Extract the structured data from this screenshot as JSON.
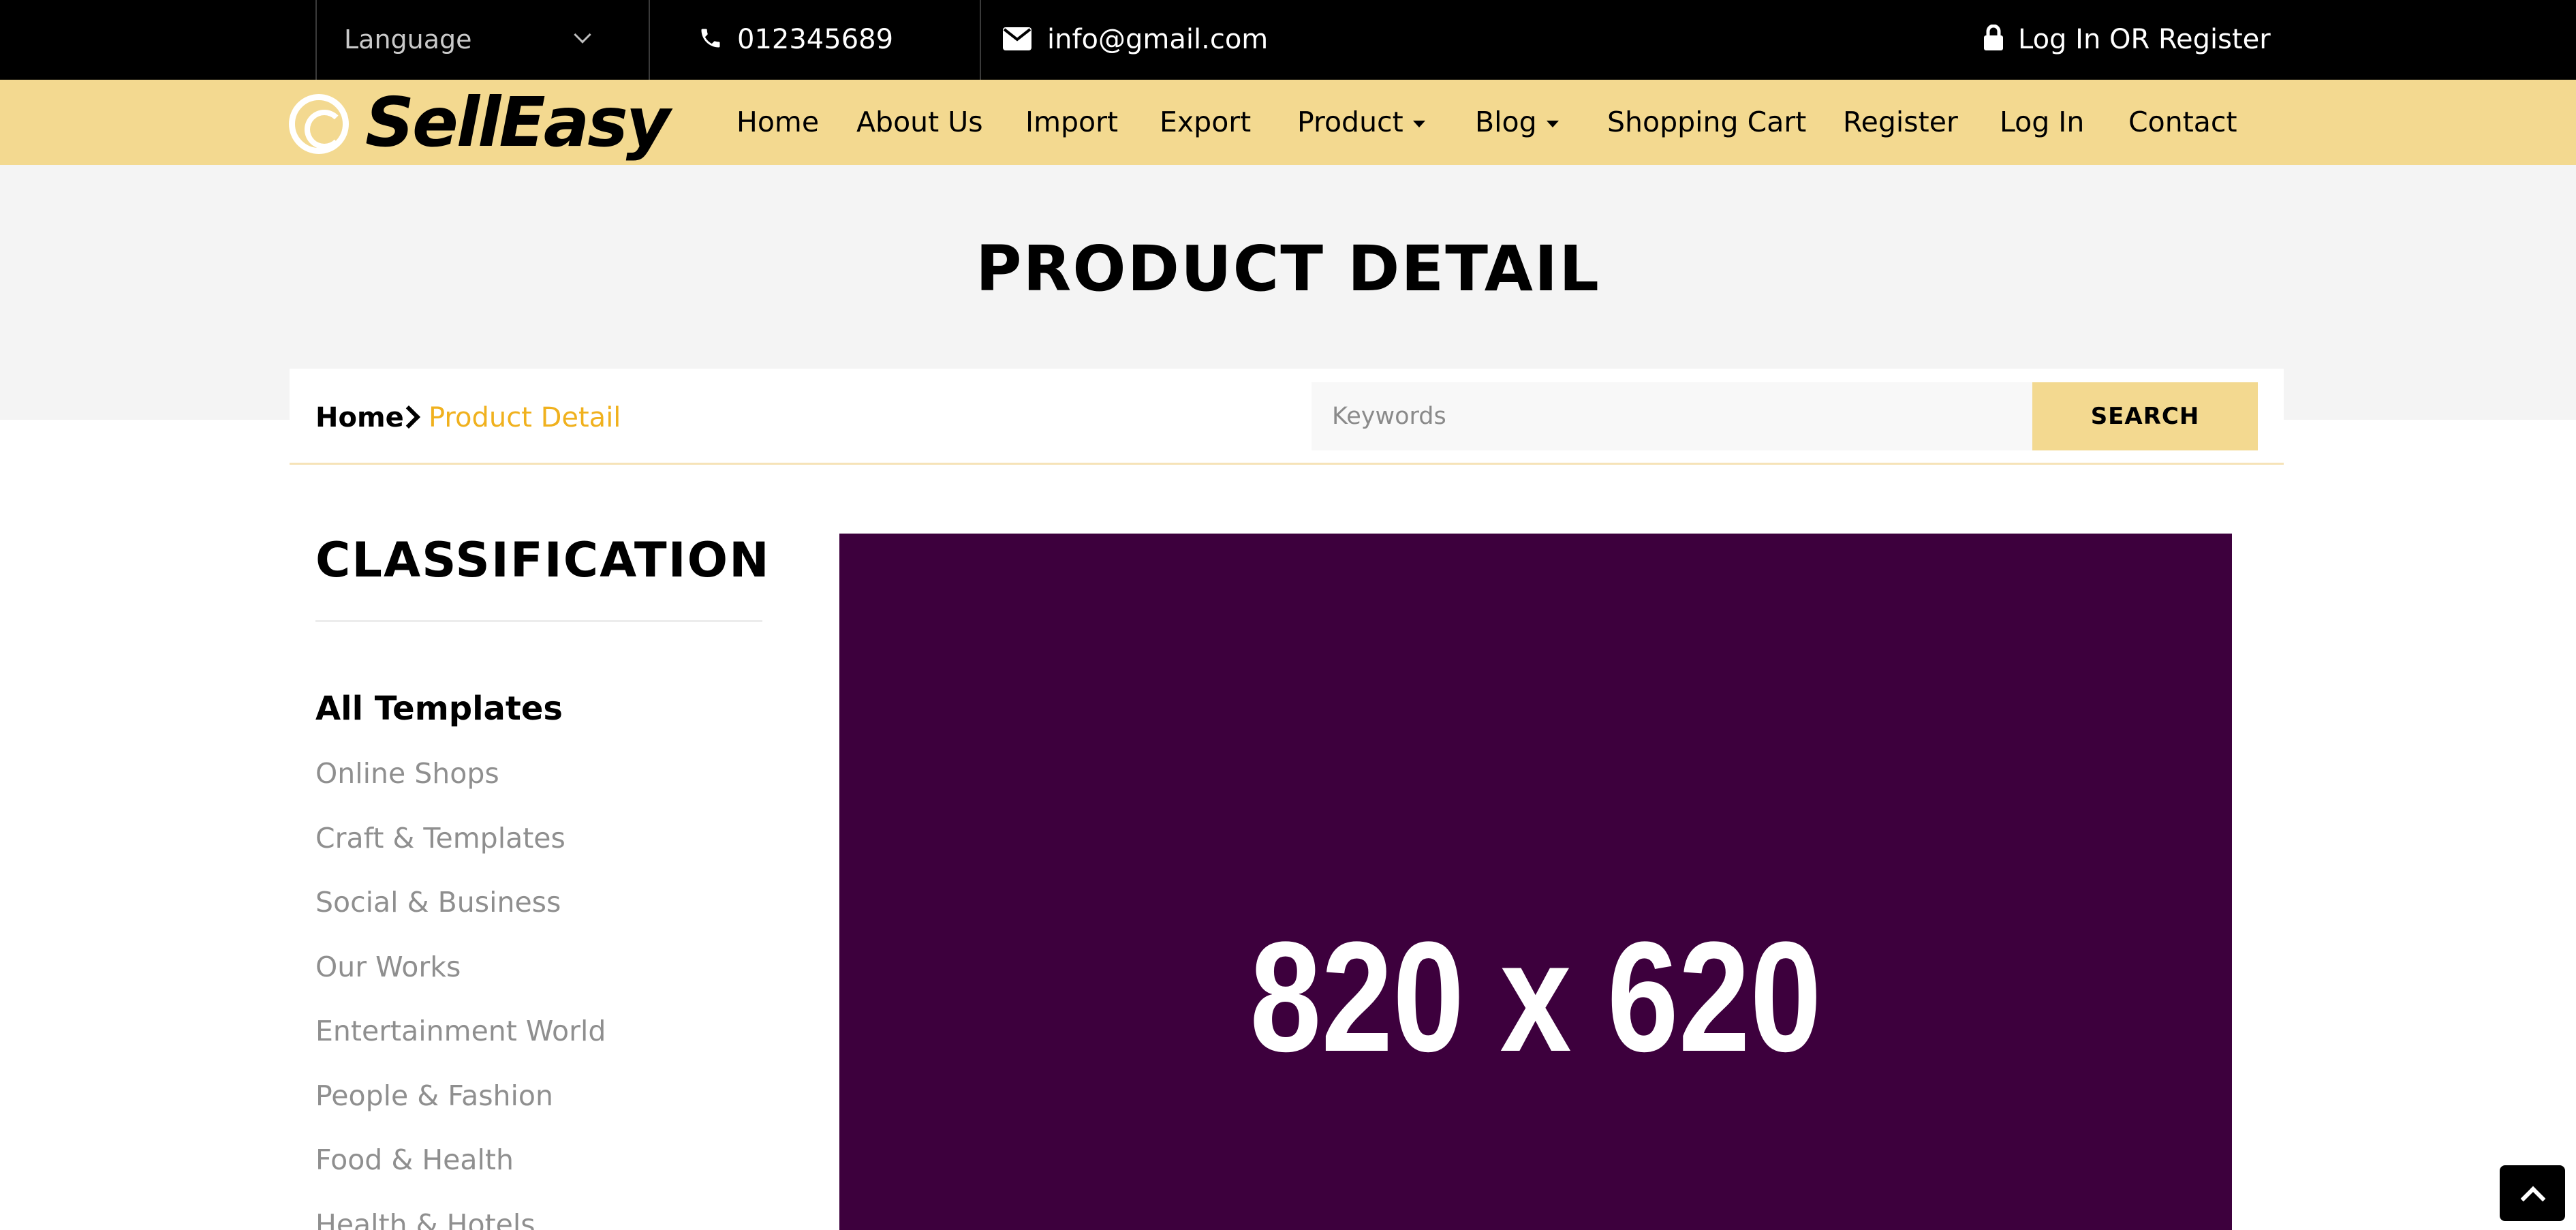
{
  "topbar": {
    "language_label": "Language",
    "phone": "012345689",
    "email": "info@gmail.com",
    "login_label": "Log In OR Register"
  },
  "brand": {
    "name": "SellEasy",
    "logo_icon": "copyright-circle-icon"
  },
  "nav": {
    "items": [
      {
        "label": "Home"
      },
      {
        "label": "About Us"
      },
      {
        "label": "Import"
      },
      {
        "label": "Export"
      },
      {
        "label": "Product",
        "dropdown": true
      },
      {
        "label": "Blog",
        "dropdown": true
      },
      {
        "label": "Shopping Cart"
      },
      {
        "label": "Register"
      },
      {
        "label": "Log In"
      },
      {
        "label": "Contact"
      }
    ]
  },
  "page": {
    "title": "PRODUCT DETAIL"
  },
  "breadcrumb": {
    "home": "Home",
    "current": "Product Detail"
  },
  "search": {
    "placeholder": "Keywords",
    "button_label": "SEARCH"
  },
  "sidebar": {
    "title": "CLASSIFICATION",
    "all_label": "All Templates",
    "categories": [
      "Online Shops",
      "Craft & Templates",
      "Social & Business",
      "Our Works",
      "Entertainment World",
      "People & Fashion",
      "Food & Health",
      "Health & Hotels"
    ]
  },
  "product": {
    "image_label": "820 x 620"
  },
  "colors": {
    "accent": "#f3d990",
    "breadcrumb_active": "#f0b11e",
    "image_bg": "#3d003d",
    "topbar_bg": "#000000"
  }
}
